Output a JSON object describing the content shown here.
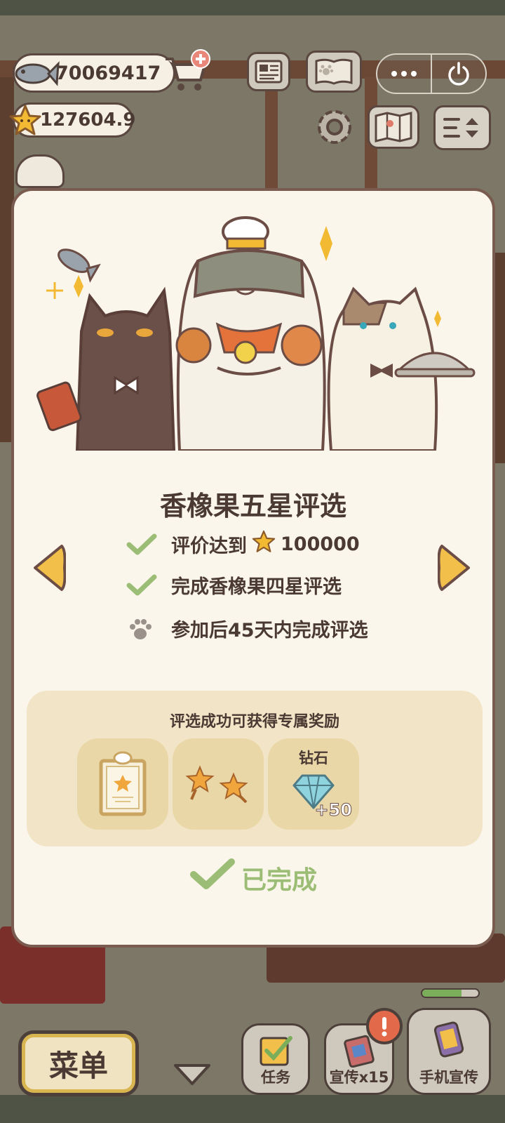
{
  "hud": {
    "fish_count": "70069417",
    "star_rating": "127604.9"
  },
  "modal": {
    "title": "香橡果五星评选",
    "requirements": [
      {
        "text": "评价达到",
        "value": "100000",
        "status": "completed",
        "icon": "check-icon"
      },
      {
        "text": "完成香橡果四星评选",
        "status": "completed",
        "icon": "check-icon"
      },
      {
        "text": "参加后45天内完成评选",
        "status": "pending",
        "icon": "paw-icon"
      }
    ],
    "rewards": {
      "title": "评选成功可获得专属奖励",
      "items": [
        {
          "icon": "certificate-frame-icon",
          "label": ""
        },
        {
          "icon": "star-badges-icon",
          "label": ""
        },
        {
          "icon": "diamond-icon",
          "label": "钻石",
          "amount": "+50"
        }
      ]
    },
    "status_label": "已完成"
  },
  "bottom_bar": {
    "menu_label": "菜单",
    "task_label": "任务",
    "promo_label": "宣传x15",
    "phone_promo_label": "手机宣传"
  },
  "colors": {
    "modal_bg": "#fbf6ec",
    "accent_yellow": "#f2b933",
    "check_green": "#9bbd75",
    "border_brown": "#7a5b4f"
  }
}
